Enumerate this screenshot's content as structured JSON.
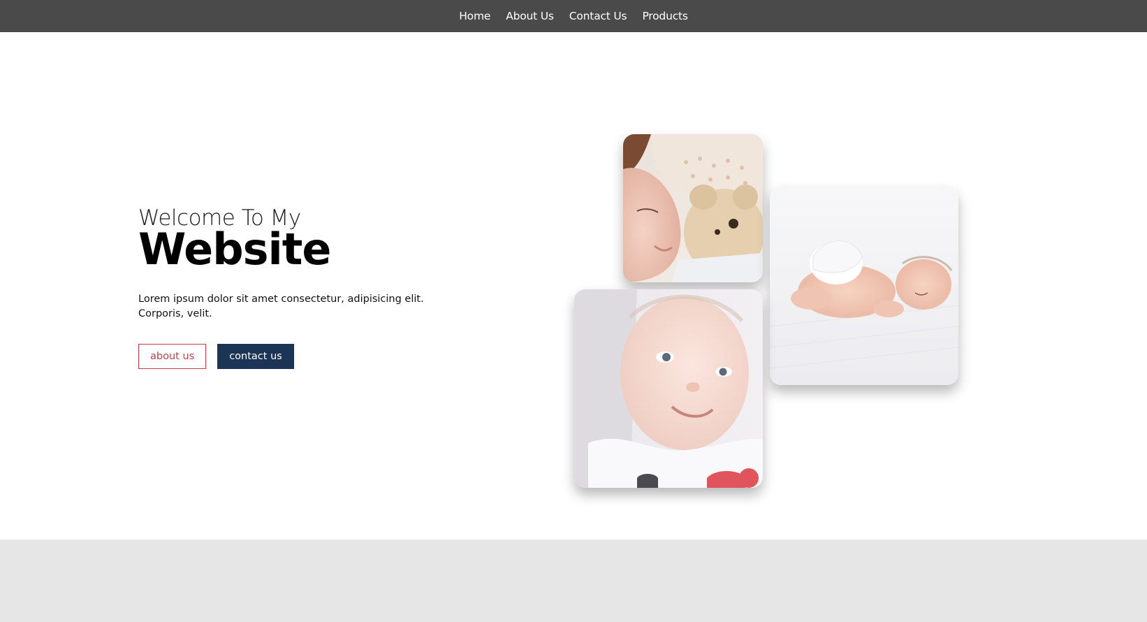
{
  "nav": {
    "items": [
      {
        "label": "Home"
      },
      {
        "label": "About Us"
      },
      {
        "label": "Contact Us"
      },
      {
        "label": "Products"
      }
    ]
  },
  "hero": {
    "welcome": "Welcome To My",
    "title": "Website",
    "description_line1": "Lorem ipsum dolor sit amet consectetur, adipisicing elit.",
    "description_line2": "Corporis, velit.",
    "about_button": "about us",
    "contact_button": "contact us"
  },
  "gallery": {
    "images": [
      {
        "name": "girl-with-teddy-bear-photo"
      },
      {
        "name": "sleeping-newborn-photo"
      },
      {
        "name": "smiling-baby-photo"
      }
    ]
  },
  "colors": {
    "nav_bg": "#4a4a4a",
    "accent_red": "#c0404a",
    "accent_navy": "#1c3557",
    "footer_bg": "#e6e6e6"
  }
}
